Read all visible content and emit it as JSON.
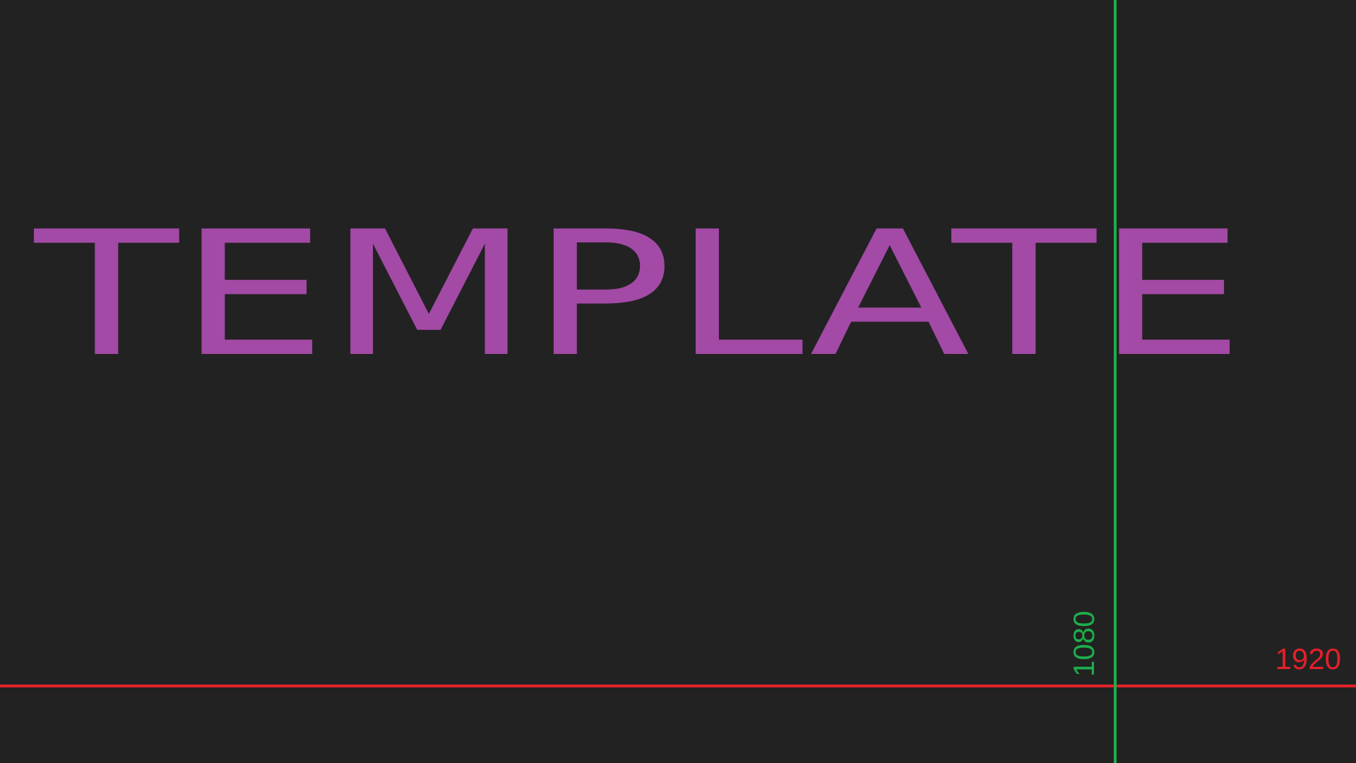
{
  "title": "TEMPLATE",
  "guides": {
    "width_label": "1920",
    "height_label": "1080",
    "width_color": "#E32129",
    "height_color": "#1DAE4C"
  },
  "colors": {
    "background": "#222222",
    "title": "#A24AA5"
  }
}
